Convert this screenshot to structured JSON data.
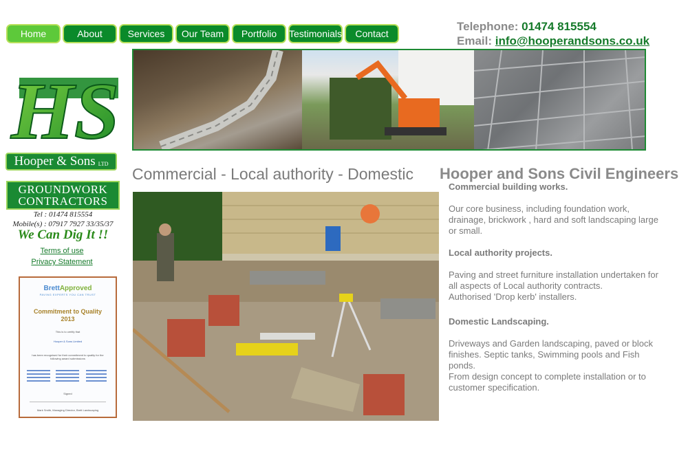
{
  "nav": [
    "Home",
    "About",
    "Services",
    "Our Team",
    "Portfolio",
    "Testimonials",
    "Contact"
  ],
  "contact": {
    "phone_label": "Telephone:",
    "phone": "01474 815554",
    "email_label": "Email:",
    "email": "info@hooperandsons.co.uk"
  },
  "logo": {
    "letters": "HS",
    "name": "Hooper & Sons",
    "ltd": "LTD"
  },
  "badge": {
    "line1": "GROUNDWORK",
    "line2": "CONTRACTORS",
    "tel": "Tel : 01474 815554",
    "mobile": "Mobile(s) : 07917 7927 33/35/37",
    "slogan": "We Can Dig It !!"
  },
  "links": {
    "terms": "Terms of use",
    "privacy": "Privacy Statement"
  },
  "certificate": {
    "brand_a": "Brett",
    "brand_b": "Approved",
    "tagline": "PAVING EXPERTS YOU CAN TRUST",
    "title": "Commitment to Quality",
    "year": "2013",
    "certify": "This is to certify that",
    "company": "Hooper & Sons Limited",
    "recognised": "has been recognised for their commitment to quality for the following award submissions",
    "signed": "Signed",
    "signatory": "Mark Smith, Managing Director, Brett Landscaping"
  },
  "headline": "Commercial - Local authority - Domestic",
  "main": {
    "title": "Hooper and Sons Civil Engineers",
    "commercial_heading": "Commercial building works.",
    "commercial_text": "Our core business, including foundation work, drainage, brickwork , hard and soft landscaping large or small.",
    "local_heading": "Local authority projects.",
    "local_text": "Paving and street furniture installation undertaken for all aspects of Local authority contracts.",
    "local_text2": "Authorised 'Drop kerb' installers.",
    "domestic_heading": "Domestic Landscaping.",
    "domestic_text": "Driveways and Garden landscaping, paved or block finishes. Septic tanks, Swimming pools and Fish ponds.",
    "domestic_text2": "From design concept to complete installation or to customer specification."
  }
}
